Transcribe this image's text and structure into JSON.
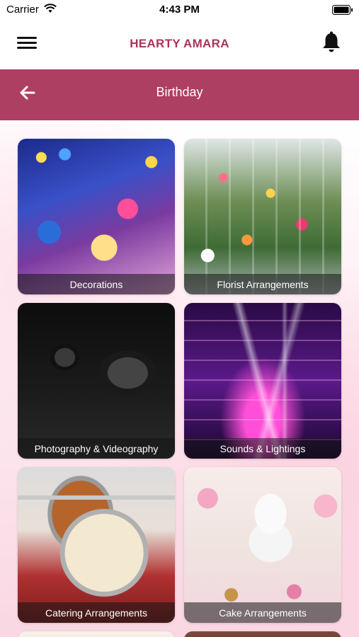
{
  "status_bar": {
    "carrier": "Carrier",
    "time": "4:43 PM"
  },
  "header": {
    "app_title": "HEARTY AMARA",
    "menu_icon": "hamburger-menu-icon",
    "bell_icon": "notification-bell-icon"
  },
  "title_bar": {
    "back_icon": "arrow-left-icon",
    "title": "Birthday"
  },
  "colors": {
    "brand": "#A8345A",
    "title_bar": "#AD3F62"
  },
  "categories": [
    {
      "label": "Decorations"
    },
    {
      "label": "Florist Arrangements"
    },
    {
      "label": "Photography & Videography"
    },
    {
      "label": "Sounds & Lightings"
    },
    {
      "label": "Catering Arrangements"
    },
    {
      "label": "Cake Arrangements"
    }
  ]
}
